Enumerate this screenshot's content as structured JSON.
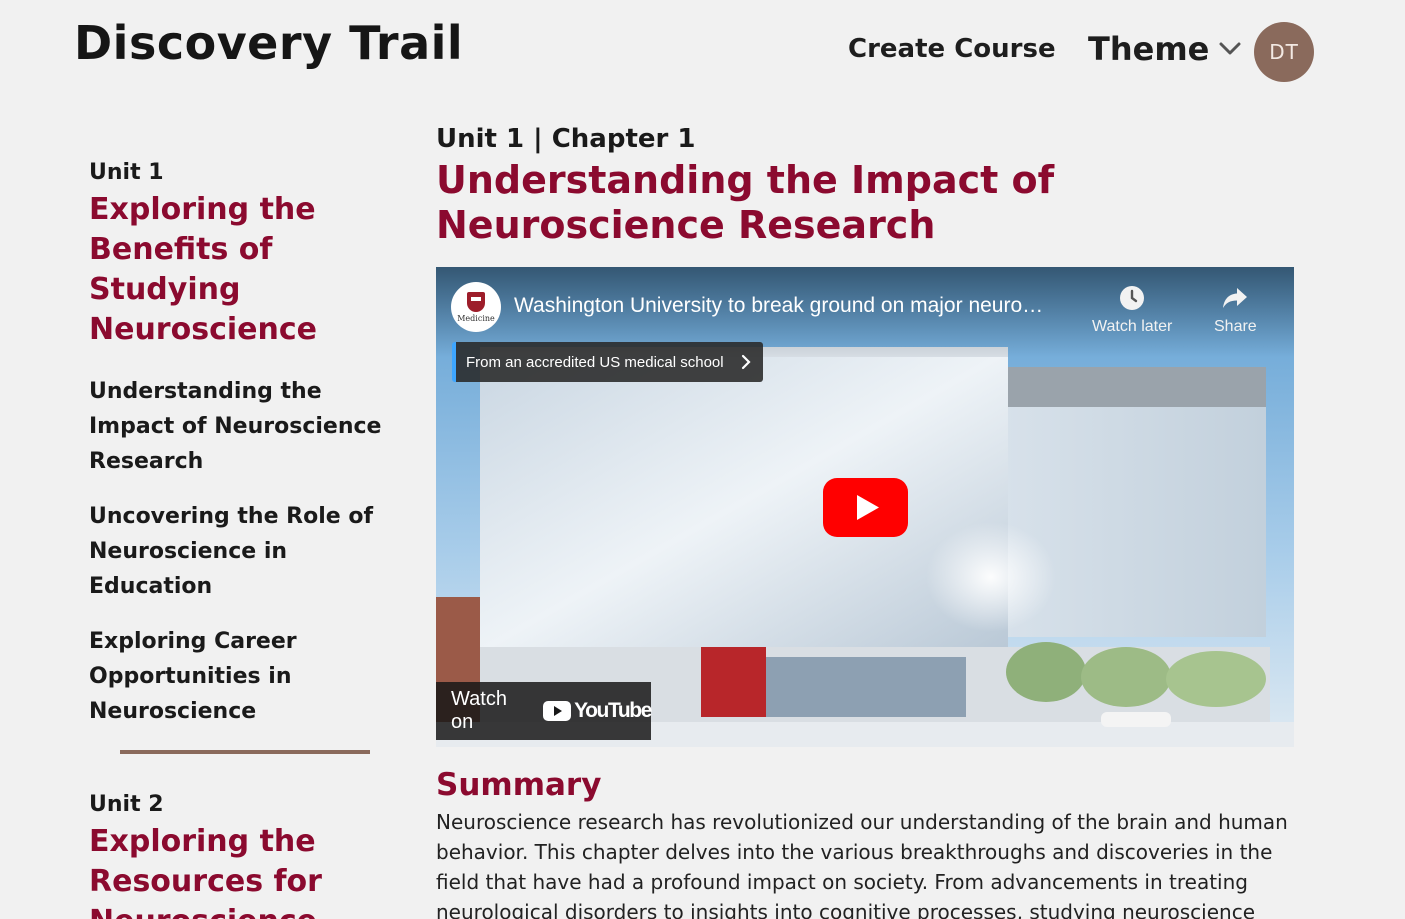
{
  "app": {
    "brand": "Discovery Trail"
  },
  "nav": {
    "create_course": "Create Course",
    "theme": "Theme",
    "avatar_initials": "DT"
  },
  "sidebar": {
    "units": [
      {
        "label": "Unit 1",
        "title": "Exploring the Benefits of Studying Neuroscience",
        "chapters": [
          "Understanding the Impact of Neuroscience Research",
          "Uncovering the Role of Neuroscience in Education",
          "Exploring Career Opportunities in Neuroscience"
        ]
      },
      {
        "label": "Unit 2",
        "title": "Exploring the Resources for Neuroscience"
      }
    ]
  },
  "main": {
    "breadcrumb": "Unit 1 | Chapter 1",
    "title": "Understanding the Impact of Neuroscience Research"
  },
  "video": {
    "title": "Washington University to break ground on major neuro…",
    "channel_logo_text": "Medicine",
    "watch_later": "Watch later",
    "share": "Share",
    "info_chip": "From an accredited US medical school",
    "watch_on": "Watch on",
    "youtube_word": "YouTube",
    "colors": {
      "play_red": "#ff0000",
      "chip_accent": "#3ea6ff"
    }
  },
  "summary": {
    "heading": "Summary",
    "text": "Neuroscience research has revolutionized our understanding of the brain and human behavior. This chapter delves into the various breakthroughs and discoveries in the field that have had a profound impact on society. From advancements in treating neurological disorders to insights into cognitive processes, studying neuroscience"
  },
  "colors": {
    "accent": "#8b0a2f",
    "background": "#f1f1f1",
    "divider": "#8a6a5c",
    "avatar_bg": "#8a6a5c"
  }
}
